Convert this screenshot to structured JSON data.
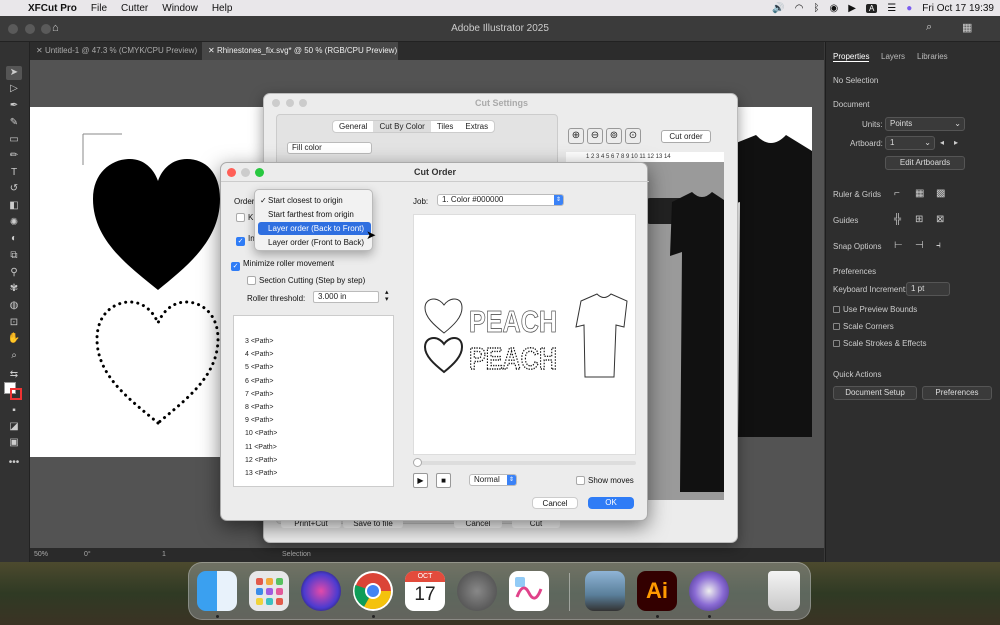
{
  "menubar": {
    "app_name": "XFCut Pro",
    "items": [
      "File",
      "Cutter",
      "Window",
      "Help"
    ],
    "input_badge": "A",
    "clock": "Fri Oct 17  19:39"
  },
  "window": {
    "title": "Adobe Illustrator 2025"
  },
  "tabs": [
    {
      "label": "Untitled-1 @ 47.3 % (CMYK/CPU Preview)"
    },
    {
      "label": "Rhinestones_fix.svg* @ 50 % (RGB/CPU Preview)"
    }
  ],
  "right_panel": {
    "tabs": [
      "Properties",
      "Layers",
      "Libraries"
    ],
    "no_selection": "No Selection",
    "document_label": "Document",
    "units_label": "Units:",
    "units_value": "Points",
    "artboard_label": "Artboard:",
    "artboard_value": "1",
    "edit_artboards": "Edit Artboards",
    "ruler_grids": "Ruler & Grids",
    "guides": "Guides",
    "snap_options": "Snap Options",
    "preferences_label": "Preferences",
    "keyboard_increment_label": "Keyboard Increment:",
    "keyboard_increment_value": "1 pt",
    "use_preview_bounds": "Use Preview Bounds",
    "scale_corners": "Scale Corners",
    "scale_strokes": "Scale Strokes & Effects",
    "quick_actions": "Quick Actions",
    "document_setup": "Document Setup",
    "preferences_button": "Preferences"
  },
  "status_bar": {
    "zoom": "50%",
    "angle": "0°",
    "artboard": "1",
    "mode": "Selection"
  },
  "cut_settings": {
    "title": "Cut Settings",
    "tabs": [
      "General",
      "Cut By Color",
      "Tiles",
      "Extras"
    ],
    "fill_select": "Fill color",
    "cut_order_button": "Cut order",
    "ruler_text": "1 2 3 4 5 6 7 8 9 10 11 12 13 14",
    "bottom_buttons": [
      "Print+Cut",
      "Save to file",
      "Cancel",
      "Cut"
    ]
  },
  "cut_order": {
    "title": "Cut Order",
    "order_label": "Order",
    "k_label": "K",
    "in_label": "In",
    "order_options": [
      "Start closest to origin",
      "Start farthest from origin",
      "Layer order (Back to Front)",
      "Layer order (Front to Back)"
    ],
    "checkmark": "✓",
    "selected_index": 0,
    "highlighted_index": 2,
    "minimize_roller": "Minimize roller movement",
    "section_cutting": "Section Cutting (Step by step)",
    "roller_threshold_label": "Roller threshold:",
    "roller_threshold_value": "3.000 in",
    "paths": [
      "3 <Path>",
      "4 <Path>",
      "5 <Path>",
      "6 <Path>",
      "7 <Path>",
      "8 <Path>",
      "9 <Path>",
      "10 <Path>",
      "11 <Path>",
      "12 <Path>",
      "13 <Path>"
    ],
    "job_label": "Job:",
    "job_value": "1. Color #000000",
    "preview_words": [
      "PEACH",
      "PEACH"
    ],
    "speed_value": "Normal",
    "show_moves": "Show moves",
    "cancel": "Cancel",
    "ok": "OK"
  },
  "dock": {
    "calendar_month": "OCT",
    "calendar_day": "17",
    "ai_label": "Ai"
  },
  "colors": {
    "accent": "#2f7cf6",
    "ai_orange": "#ff9a00"
  }
}
